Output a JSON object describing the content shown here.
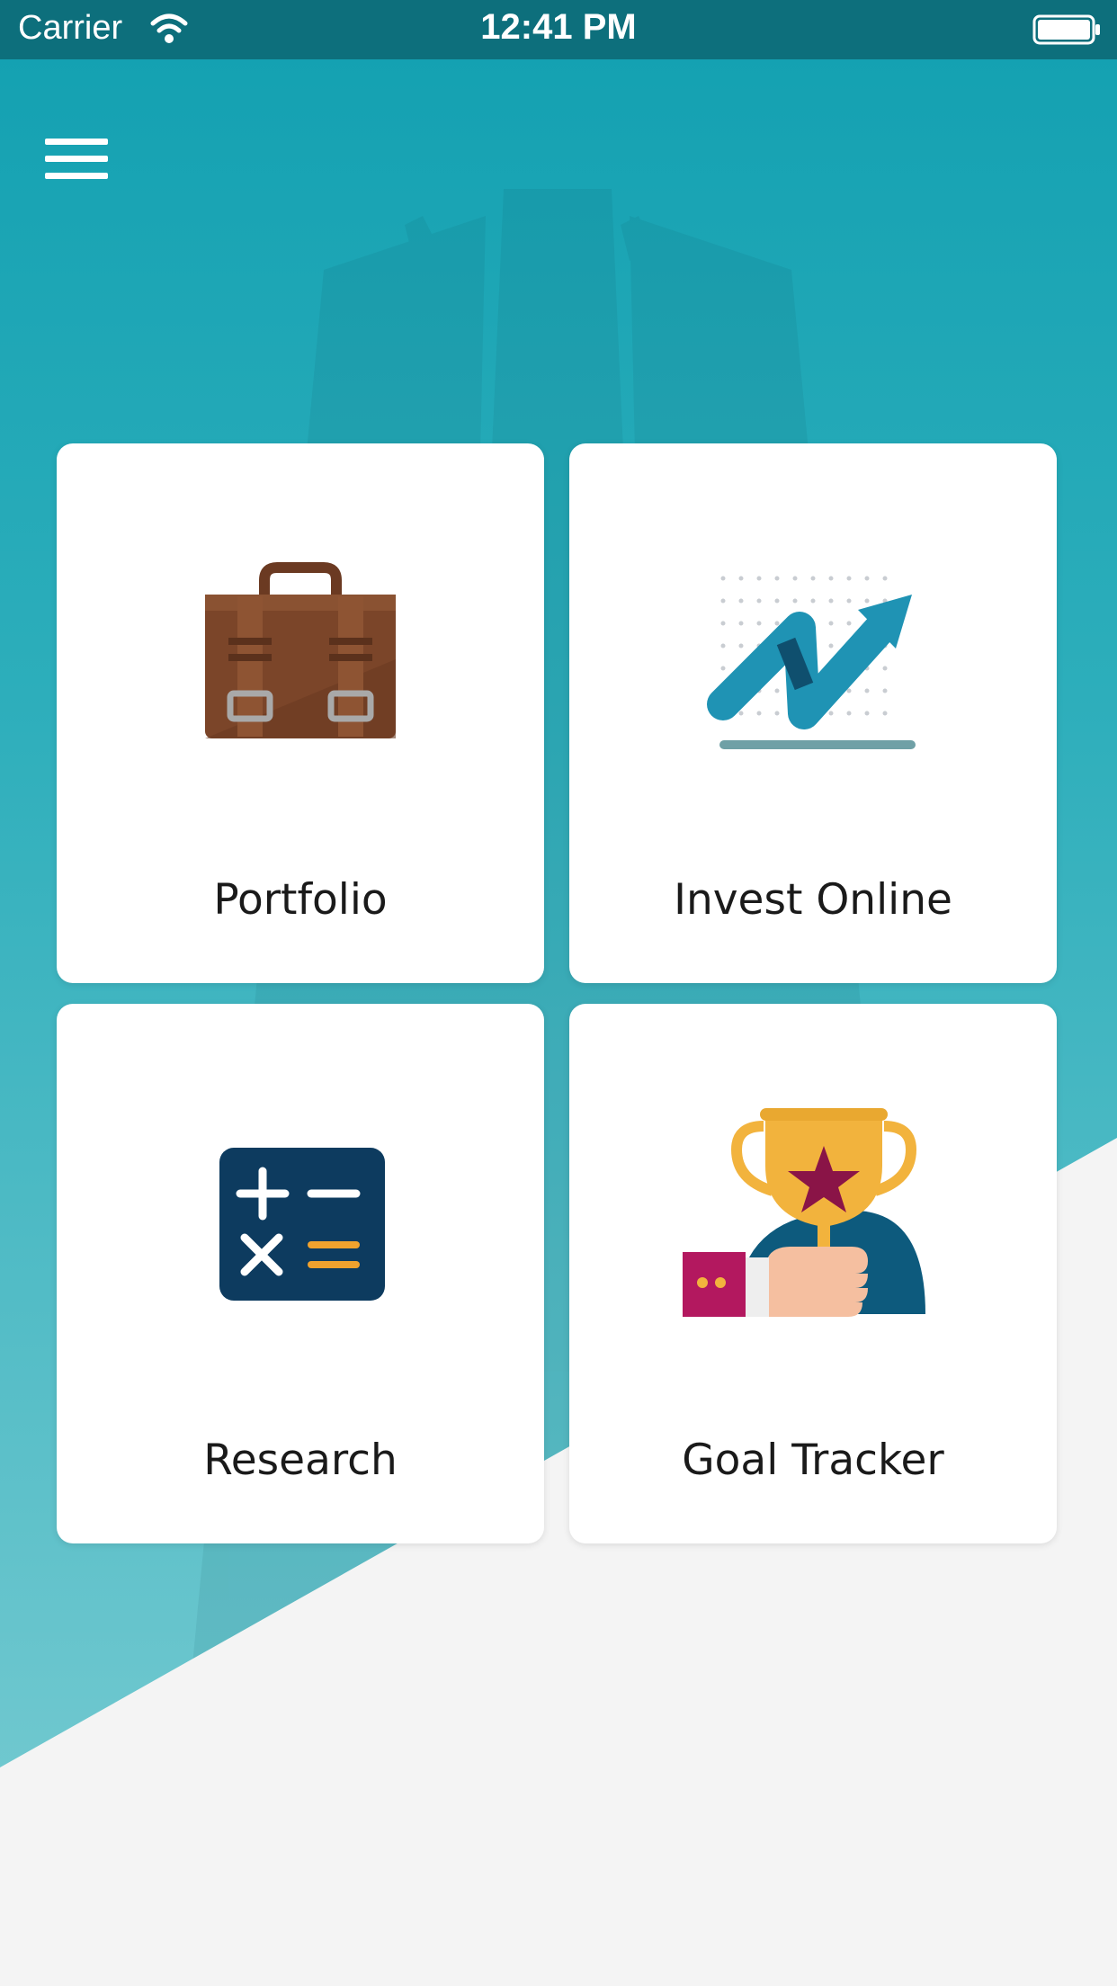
{
  "status_bar": {
    "carrier": "Carrier",
    "time": "12:41 PM",
    "wifi_icon": "wifi-icon",
    "battery_icon": "battery-full-icon"
  },
  "header": {
    "menu_icon": "hamburger-menu-icon"
  },
  "tiles": [
    {
      "label": "Portfolio",
      "icon": "briefcase-icon"
    },
    {
      "label": "Invest Online",
      "icon": "growth-arrow-chart-icon"
    },
    {
      "label": "Research",
      "icon": "calculator-icon"
    },
    {
      "label": "Goal Tracker",
      "icon": "trophy-hand-icon"
    }
  ],
  "colors": {
    "status_bar": "#0d6f7c",
    "teal_top": "#12a0b1",
    "teal_bottom": "#7ccdd3",
    "page_bg": "#f4f4f4",
    "tile_bg": "#ffffff"
  }
}
